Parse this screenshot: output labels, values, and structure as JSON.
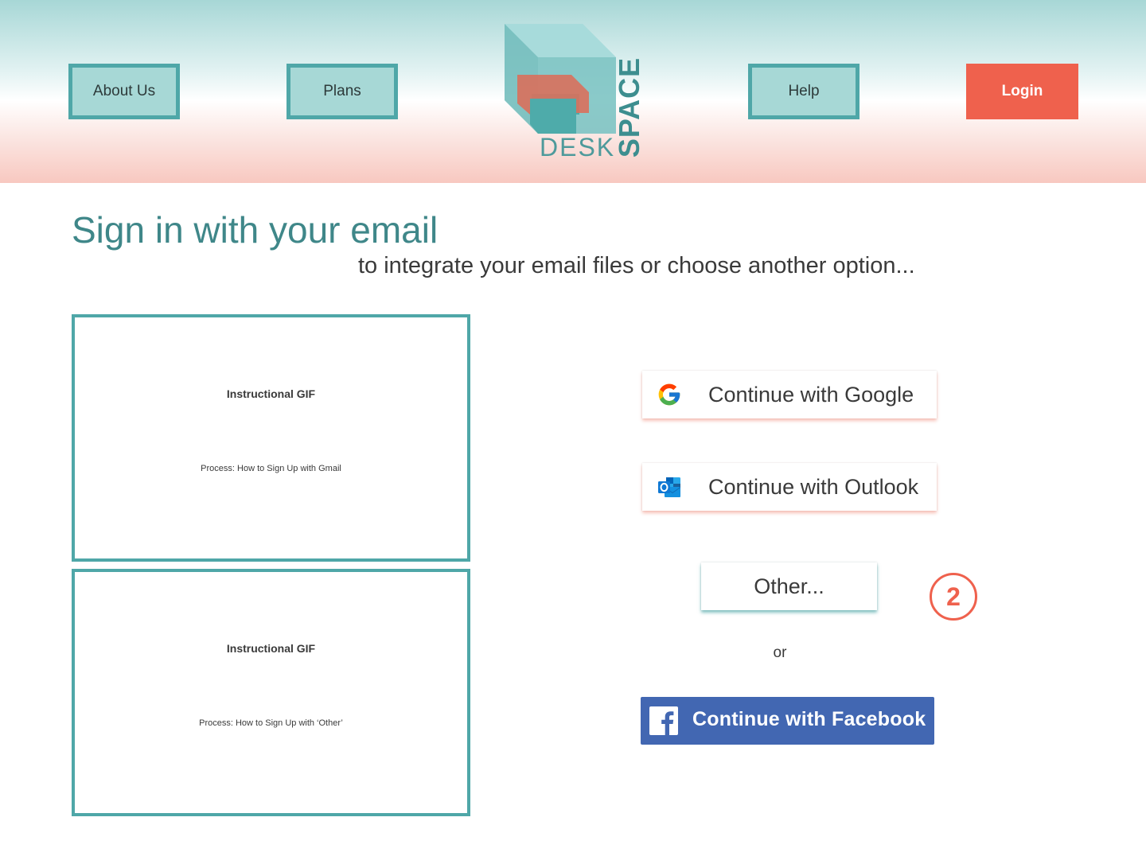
{
  "nav": {
    "about_label": "About Us",
    "plans_label": "Plans",
    "help_label": "Help",
    "login_label": "Login"
  },
  "logo": {
    "word_desk": "DESK",
    "word_space": "SPACE"
  },
  "main": {
    "title": "Sign in with your email",
    "subtitle": "to integrate your email files or choose another option..."
  },
  "gifs": [
    {
      "title": "Instructional GIF",
      "caption": "Process: How to Sign Up with Gmail"
    },
    {
      "title": "Instructional GIF",
      "caption": "Process: How to Sign Up with ‘Other’"
    }
  ],
  "signin": {
    "google_label": "Continue with Google",
    "outlook_label": "Continue with Outlook",
    "other_label": "Other...",
    "step_number": "2",
    "or_text": "or",
    "facebook_label": "Continue with Facebook"
  },
  "colors": {
    "teal": "#4fa7a8",
    "teal_light": "#a7d8d6",
    "coral": "#ef614d",
    "facebook_blue": "#4267b2"
  },
  "icons": [
    "google-icon",
    "outlook-icon",
    "facebook-icon"
  ]
}
